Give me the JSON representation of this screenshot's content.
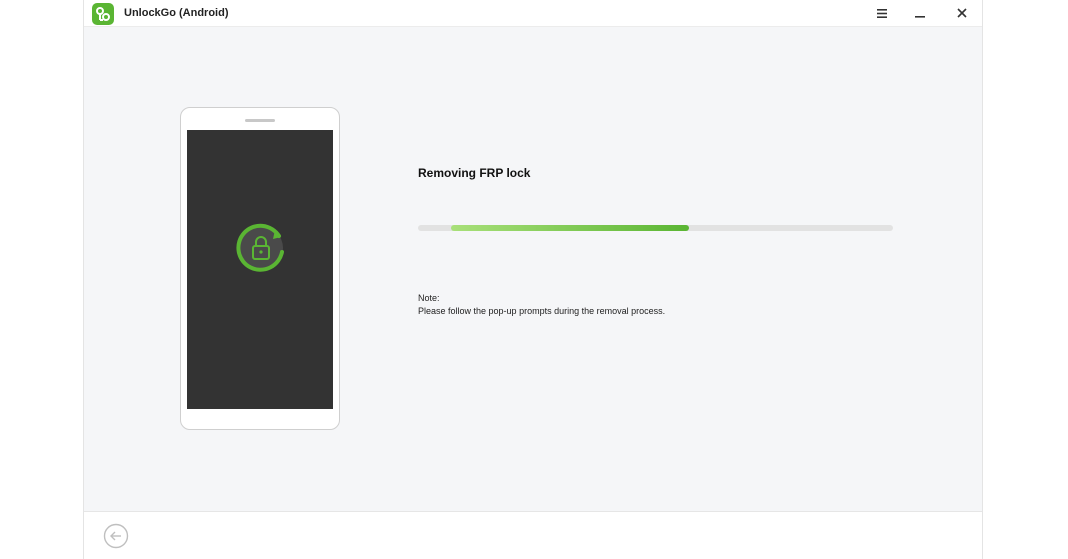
{
  "window": {
    "title": "UnlockGo (Android)",
    "controls": {
      "menu": "menu-icon",
      "minimize": "minimize-icon",
      "close": "close-icon"
    }
  },
  "device": {
    "icon": "lock-refresh-icon"
  },
  "main": {
    "status_title": "Removing FRP lock",
    "progress": {
      "start_fraction": 0.07,
      "fraction": 0.57
    },
    "note_label": "Note:",
    "note_text": "Please follow the pop-up prompts during the removal process."
  },
  "footer": {
    "back_icon": "back-arrow-icon"
  },
  "colors": {
    "accent": "#5ab533",
    "accent_light": "#a9e07a",
    "content_bg": "#f5f6f8",
    "phone_screen": "#333333"
  }
}
